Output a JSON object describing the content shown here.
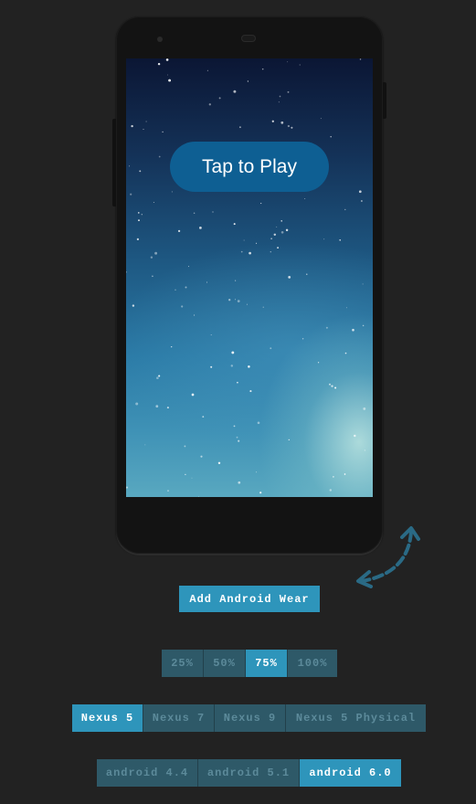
{
  "emulator": {
    "play_label": "Tap to Play",
    "add_wear_label": "Add Android Wear"
  },
  "scale": {
    "options": [
      "25%",
      "50%",
      "75%",
      "100%"
    ],
    "selected": "75%"
  },
  "devices": {
    "options": [
      "Nexus 5",
      "Nexus 7",
      "Nexus 9",
      "Nexus 5 Physical"
    ],
    "selected": "Nexus 5"
  },
  "android_versions": {
    "options": [
      "android 4.4",
      "android 5.1",
      "android 6.0"
    ],
    "selected": "android 6.0"
  },
  "colors": {
    "background": "#222222",
    "accent": "#2e95bb",
    "inactive": "#2e5968",
    "play_button": "#0e5f93"
  },
  "icons": {
    "rotate": "rotate-arrow-icon"
  }
}
